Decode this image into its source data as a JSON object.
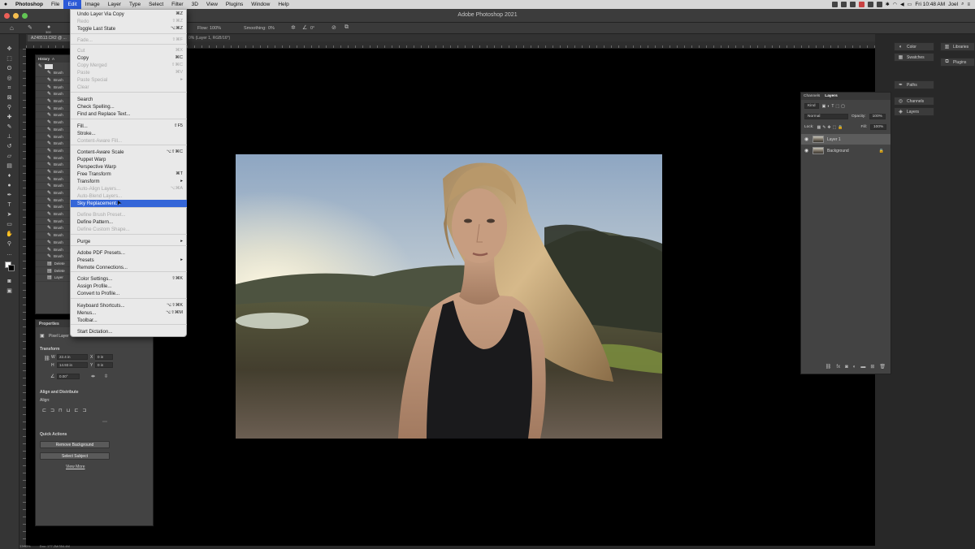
{
  "menubar": {
    "apple": "",
    "items": [
      "Photoshop",
      "File",
      "Edit",
      "Image",
      "Layer",
      "Type",
      "Select",
      "Filter",
      "3D",
      "View",
      "Plugins",
      "Window",
      "Help"
    ],
    "active_index": 2,
    "clock": "Fri 10:48 AM",
    "user": "Joel"
  },
  "window": {
    "title": "Adobe Photoshop 2021"
  },
  "options_bar": {
    "size": "300",
    "flow_label": "Flow:",
    "flow_value": "100%",
    "smoothing_label": "Smoothing:",
    "smoothing_value": "0%",
    "angle": "0°"
  },
  "document": {
    "tab_name": "AZ48513.CR2 @ ...",
    "tab_suffix": "0% (Layer 1, RGB/16*)"
  },
  "history": {
    "tabs": [
      "History",
      "A"
    ],
    "rows": [
      "Brush",
      "Brush",
      "Brush",
      "Brush",
      "Brush",
      "Brush",
      "Brush",
      "Brush",
      "Brush",
      "Brush",
      "Brush",
      "Brush",
      "Brush",
      "Brush",
      "Brush",
      "Brush",
      "Brush",
      "Brush",
      "Brush",
      "Brush",
      "Brush",
      "Brush",
      "Brush",
      "Brush",
      "Brush",
      "Brush",
      "Brush",
      "Delete",
      "Delete",
      "Layer"
    ]
  },
  "edit_menu": {
    "items": [
      {
        "label": "Undo Layer Via Copy",
        "shortcut": "⌘Z",
        "disabled": false
      },
      {
        "label": "Redo",
        "shortcut": "⇧⌘Z",
        "disabled": true
      },
      {
        "label": "Toggle Last State",
        "shortcut": "⌥⌘Z",
        "disabled": false
      },
      {
        "label": "Fade...",
        "shortcut": "⇧⌘F",
        "disabled": true
      },
      {
        "label": "Cut",
        "shortcut": "⌘X",
        "disabled": true
      },
      {
        "label": "Copy",
        "shortcut": "⌘C",
        "disabled": false
      },
      {
        "label": "Copy Merged",
        "shortcut": "⇧⌘C",
        "disabled": true
      },
      {
        "label": "Paste",
        "shortcut": "⌘V",
        "disabled": true
      },
      {
        "label": "Paste Special",
        "shortcut": "▸",
        "disabled": true
      },
      {
        "label": "Clear",
        "shortcut": "",
        "disabled": true
      },
      {
        "label": "Search",
        "shortcut": "",
        "disabled": false
      },
      {
        "label": "Check Spelling...",
        "shortcut": "",
        "disabled": false
      },
      {
        "label": "Find and Replace Text...",
        "shortcut": "",
        "disabled": false
      },
      {
        "label": "Fill...",
        "shortcut": "⇧F5",
        "disabled": false
      },
      {
        "label": "Stroke...",
        "shortcut": "",
        "disabled": false
      },
      {
        "label": "Content-Aware Fill...",
        "shortcut": "",
        "disabled": true
      },
      {
        "label": "Content-Aware Scale",
        "shortcut": "⌥⇧⌘C",
        "disabled": false
      },
      {
        "label": "Puppet Warp",
        "shortcut": "",
        "disabled": false
      },
      {
        "label": "Perspective Warp",
        "shortcut": "",
        "disabled": false
      },
      {
        "label": "Free Transform",
        "shortcut": "⌘T",
        "disabled": false
      },
      {
        "label": "Transform",
        "shortcut": "▸",
        "disabled": false
      },
      {
        "label": "Auto-Align Layers...",
        "shortcut": "⌥⌘A",
        "disabled": true
      },
      {
        "label": "Auto-Blend Layers...",
        "shortcut": "",
        "disabled": true
      },
      {
        "label": "Sky Replacement...",
        "shortcut": "",
        "disabled": false
      },
      {
        "label": "Define Brush Preset...",
        "shortcut": "",
        "disabled": true
      },
      {
        "label": "Define Pattern...",
        "shortcut": "",
        "disabled": false
      },
      {
        "label": "Define Custom Shape...",
        "shortcut": "",
        "disabled": true
      },
      {
        "label": "Purge",
        "shortcut": "▸",
        "disabled": false
      },
      {
        "label": "Adobe PDF Presets...",
        "shortcut": "",
        "disabled": false
      },
      {
        "label": "Presets",
        "shortcut": "▸",
        "disabled": false
      },
      {
        "label": "Remote Connections...",
        "shortcut": "",
        "disabled": false
      },
      {
        "label": "Color Settings...",
        "shortcut": "⇧⌘K",
        "disabled": false
      },
      {
        "label": "Assign Profile...",
        "shortcut": "",
        "disabled": false
      },
      {
        "label": "Convert to Profile...",
        "shortcut": "",
        "disabled": false
      },
      {
        "label": "Keyboard Shortcuts...",
        "shortcut": "⌥⇧⌘K",
        "disabled": false
      },
      {
        "label": "Menus...",
        "shortcut": "⌥⇧⌘M",
        "disabled": false
      },
      {
        "label": "Toolbar...",
        "shortcut": "",
        "disabled": false
      },
      {
        "label": "Start Dictation...",
        "shortcut": "",
        "disabled": false
      }
    ]
  },
  "properties": {
    "title": "Properties",
    "layer_kind": "Pixel Layer",
    "transform_title": "Transform",
    "w_label": "W",
    "w_value": "22.4 in",
    "h_label": "H",
    "h_value": "14.93 in",
    "x_label": "X",
    "x_value": "0 in",
    "y_label": "Y",
    "y_value": "0 in",
    "angle": "0.00°",
    "align_title": "Align and Distribute",
    "align_label": "Align:",
    "quick_actions_title": "Quick Actions",
    "remove_bg": "Remove Background",
    "select_subject": "Select Subject",
    "view_more": "View More"
  },
  "layers": {
    "tabs": [
      "Channels",
      "Layers"
    ],
    "kind_label": "Kind",
    "blend_mode": "Normal",
    "opacity_label": "Opacity:",
    "opacity": "100%",
    "lock_label": "Lock:",
    "fill_label": "Fill:",
    "fill": "100%",
    "rows": [
      {
        "name": "Layer 1",
        "selected": true
      },
      {
        "name": "Background",
        "selected": false
      }
    ]
  },
  "dock": {
    "mid": [
      "Color",
      "Swatches",
      "Paths",
      "Channels",
      "Layers"
    ],
    "right": [
      "Libraries",
      "Plugins"
    ]
  },
  "status": {
    "zoom": "33.33%",
    "doc": "Doc: 177.2M/354.4M"
  }
}
